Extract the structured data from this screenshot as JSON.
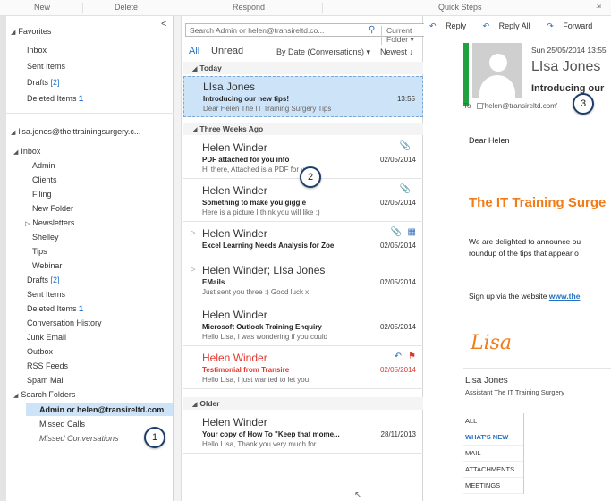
{
  "ribbon": {
    "new": "New",
    "delete": "Delete",
    "respond": "Respond",
    "quick_steps": "Quick Steps"
  },
  "folders": {
    "favorites_header": "Favorites",
    "collapse_glyph": "<",
    "favorites": [
      {
        "label": "Inbox"
      },
      {
        "label": "Sent Items"
      },
      {
        "label": "Drafts",
        "count": "[2]"
      },
      {
        "label": "Deleted Items",
        "count": "1"
      }
    ],
    "account": "lisa.jones@theittrainingsurgery.c...",
    "inbox_label": "Inbox",
    "inbox_children": [
      "Admin",
      "Clients",
      "Filing",
      "New Folder",
      "Newsletters",
      "Shelley",
      "Tips",
      "Webinar"
    ],
    "drafts": {
      "label": "Drafts",
      "count": "[2]"
    },
    "sent": "Sent Items",
    "deleted": {
      "label": "Deleted Items",
      "count": "1"
    },
    "others": [
      "Conversation History",
      "Junk Email",
      "Outbox",
      "RSS Feeds",
      "Spam Mail"
    ],
    "search_folders": "Search Folders",
    "search_children": [
      "Admin or helen@transireltd.com",
      "Missed Calls",
      "Missed Conversations"
    ]
  },
  "mail": {
    "search_placeholder": "Search Admin or helen@transireltd.co...",
    "search_scope": "Current Folder",
    "filter_all": "All",
    "filter_unread": "Unread",
    "sort_by": "By Date (Conversations)",
    "sort_order": "Newest",
    "groups": {
      "today": "Today",
      "three_weeks": "Three Weeks Ago",
      "older": "Older"
    },
    "messages": [
      {
        "from": "LIsa Jones",
        "subject": "Introducing our new tips!",
        "preview": "Dear Helen  The IT Training Surgery Tips",
        "date": "13:55"
      },
      {
        "from": "Helen Winder",
        "subject": "PDF attached for you info",
        "preview": "Hi there,  Attached is a PDF for your",
        "date": "02/05/2014"
      },
      {
        "from": "Helen Winder",
        "subject": "Something to make you giggle",
        "preview": "Here is a picture I think you will like :)",
        "date": "02/05/2014"
      },
      {
        "from": "Helen Winder",
        "subject": "Excel Learning Needs Analysis for Zoe",
        "preview": "",
        "date": "02/05/2014"
      },
      {
        "from": "Helen Winder;  LIsa Jones",
        "subject": "EMails",
        "preview": "Just sent you three :)  Good luck x",
        "date": "02/05/2014"
      },
      {
        "from": "Helen Winder",
        "subject": "Microsoft Outlook Training Enquiry",
        "preview": "Hello Lisa,  I was wondering if you could",
        "date": "02/05/2014"
      },
      {
        "from": "Helen Winder",
        "subject": "Testimonial from Transire",
        "preview": "Hello Lisa,  I just wanted to let you",
        "date": "02/05/2014"
      },
      {
        "from": "Helen Winder",
        "subject": "Your copy of How To \"Keep that mome...",
        "preview": "Hello Lisa,  Thank you very much for",
        "date": "28/11/2013"
      }
    ]
  },
  "reading": {
    "reply": "Reply",
    "reply_all": "Reply All",
    "forward": "Forward",
    "date": "Sun 25/05/2014 13:55",
    "from": "LIsa Jones",
    "subject": "Introducing our",
    "to_label": "To",
    "to_value": "'helen@transireltd.com'",
    "greeting": "Dear Helen",
    "headline": "The IT Training Surge",
    "para_line1": "We are delighted to announce ou",
    "para_line2": "roundup of the tips that appear o",
    "signup_text": "Sign up via the website",
    "signup_link": "www.the",
    "signature": "Lisa",
    "person_name": "Lisa Jones",
    "person_title": "Assistant  The IT Training Surgery",
    "tabs": [
      "ALL",
      "WHAT'S NEW",
      "MAIL",
      "ATTACHMENTS",
      "MEETINGS"
    ]
  },
  "callouts": {
    "c1": "1",
    "c2": "2",
    "c3": "3"
  },
  "icons": {
    "reply": "reply-icon",
    "search": "search-icon",
    "attachment": "paperclip-icon",
    "flag": "flag-icon"
  },
  "colors": {
    "accent": "#2372c4",
    "selection": "#cde3f7",
    "status_green": "#21a140",
    "highlight_orange": "#f07c1a",
    "flag_red": "#e0372f"
  }
}
